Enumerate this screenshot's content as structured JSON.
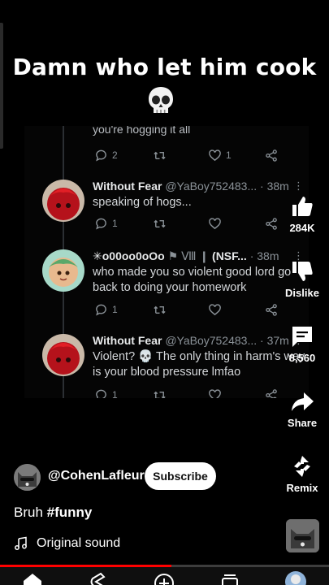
{
  "overlay": {
    "caption": "Damn who let him cook",
    "caption_emoji": "skull-emoji"
  },
  "tweet_screenshot": {
    "cutoff_text": "you're hogging it all",
    "top_actions": {
      "replies": "2",
      "retweets": "",
      "likes": "1"
    },
    "tweets": [
      {
        "name": "Without Fear",
        "handle": "@YaBoy752483...",
        "time": "· 38m",
        "text": "speaking of hogs...",
        "replies": "1",
        "retweets": "",
        "likes": ""
      },
      {
        "name": "✳o00oo0oOo",
        "badges": "⚑ Ⅷ ❙",
        "handle": "(NSF...",
        "time": "· 38m",
        "text": "who made you so violent good lord go back to doing your homework",
        "replies": "1",
        "retweets": "",
        "likes": ""
      },
      {
        "name": "Without Fear",
        "handle": "@YaBoy752483...",
        "time": "· 37m",
        "text": "Violent? 💀 The only thing in harm's way is your blood pressure lmfao",
        "replies": "1",
        "retweets": "",
        "likes": ""
      }
    ]
  },
  "actions": {
    "like_count": "284K",
    "dislike_label": "Dislike",
    "comment_count": "8,560",
    "share_label": "Share",
    "remix_label": "Remix"
  },
  "channel": {
    "name": "@CohenLafleur",
    "subscribe_label": "Subscribe"
  },
  "description": {
    "text": "Bruh",
    "hashtag": "#funny"
  },
  "sound": {
    "label": "Original sound"
  },
  "playback": {
    "progress_fraction": 0.52
  },
  "colors": {
    "accent": "#ff0000",
    "background": "#000000",
    "subscribe_bg": "#ffffff"
  }
}
